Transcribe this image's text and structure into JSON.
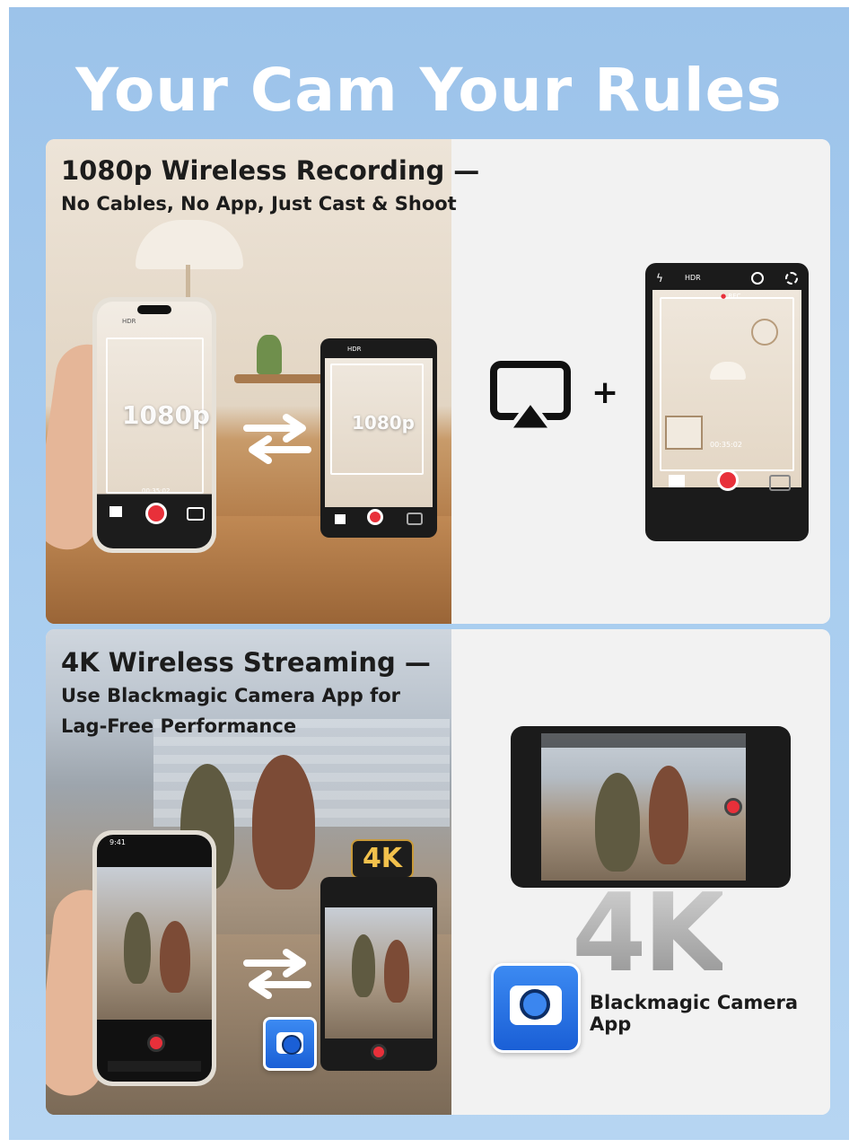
{
  "headline": "Your Cam Your Rules",
  "section1": {
    "title": "1080p Wireless Recording —",
    "subtitle": "No Cables, No App, Just Cast & Shoot",
    "overlay_big": "1080p",
    "overlay_small": "1080p",
    "rec_label": "REC",
    "hdr_label": "HDR",
    "timecode": "00:35:02",
    "plus": "+"
  },
  "section2": {
    "title": "4K Wireless Streaming —",
    "subtitle_line1": "Use Blackmagic Camera App for",
    "subtitle_line2": "Lag-Free Performance",
    "badge": "4K",
    "big_label": "4K",
    "app_label": "Blackmagic Camera App",
    "phone_time": "9:41"
  },
  "colors": {
    "background": "#a9cdef",
    "panel": "#f1f1f1",
    "record": "#e8303a",
    "app_blue": "#1a5fd6"
  },
  "icons": {
    "cast": "airplay-cast-icon",
    "swap": "swap-arrows-icon",
    "app": "camera-app-icon"
  }
}
